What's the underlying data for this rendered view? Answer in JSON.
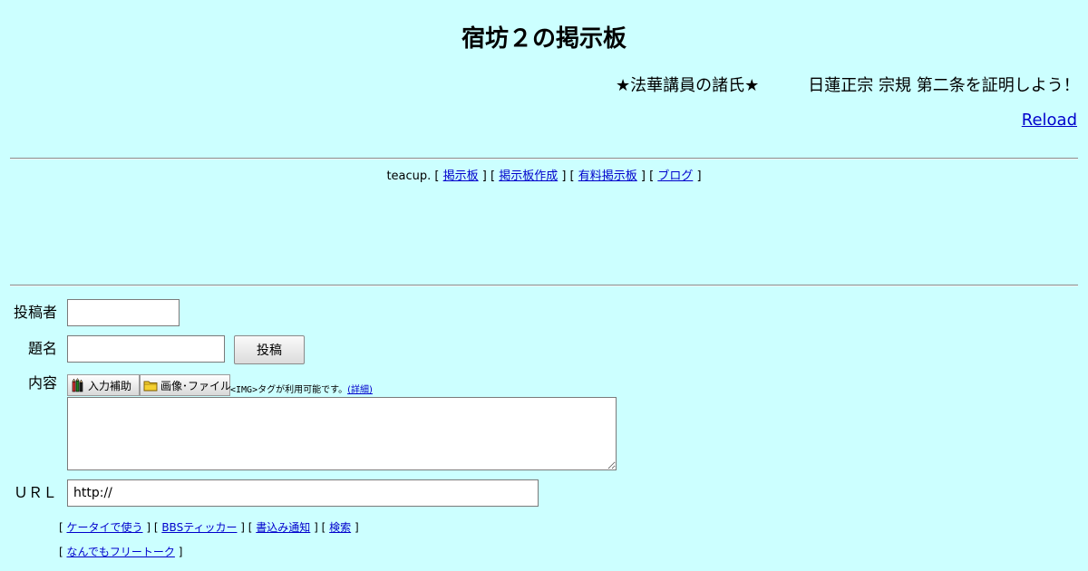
{
  "page": {
    "title": "宿坊２の掲示板",
    "marquee_left": "★法華講員の諸氏★",
    "marquee_right": "日蓮正宗 宗規 第二条を証明しよう！「",
    "reload_label": "Reload"
  },
  "service_links": {
    "prefix": "teacup.",
    "items": [
      "掲示板",
      "掲示板作成",
      "有料掲示板",
      "ブログ"
    ]
  },
  "form": {
    "author_label": "投稿者",
    "author_value": "",
    "subject_label": "題名",
    "subject_value": "",
    "submit_label": "投稿",
    "body_label": "内容",
    "input_assist_label": "入力補助",
    "image_file_label": "画像･ファイル",
    "img_tag": "<IMG>",
    "img_note_text": "タグが利用可能です。",
    "img_detail_link": "(詳細)",
    "body_value": "",
    "url_label": "ＵＲＬ",
    "url_value": "http://"
  },
  "bottom_links": {
    "row1": [
      "ケータイで使う",
      "BBSティッカー",
      "書込み通知",
      "検索"
    ],
    "row2": [
      "なんでもフリートーク"
    ]
  },
  "icons": {
    "input_assist": "pencils-icon",
    "image_file": "folder-icon"
  },
  "colors": {
    "background": "#ccffff",
    "link": "#0000cc"
  }
}
